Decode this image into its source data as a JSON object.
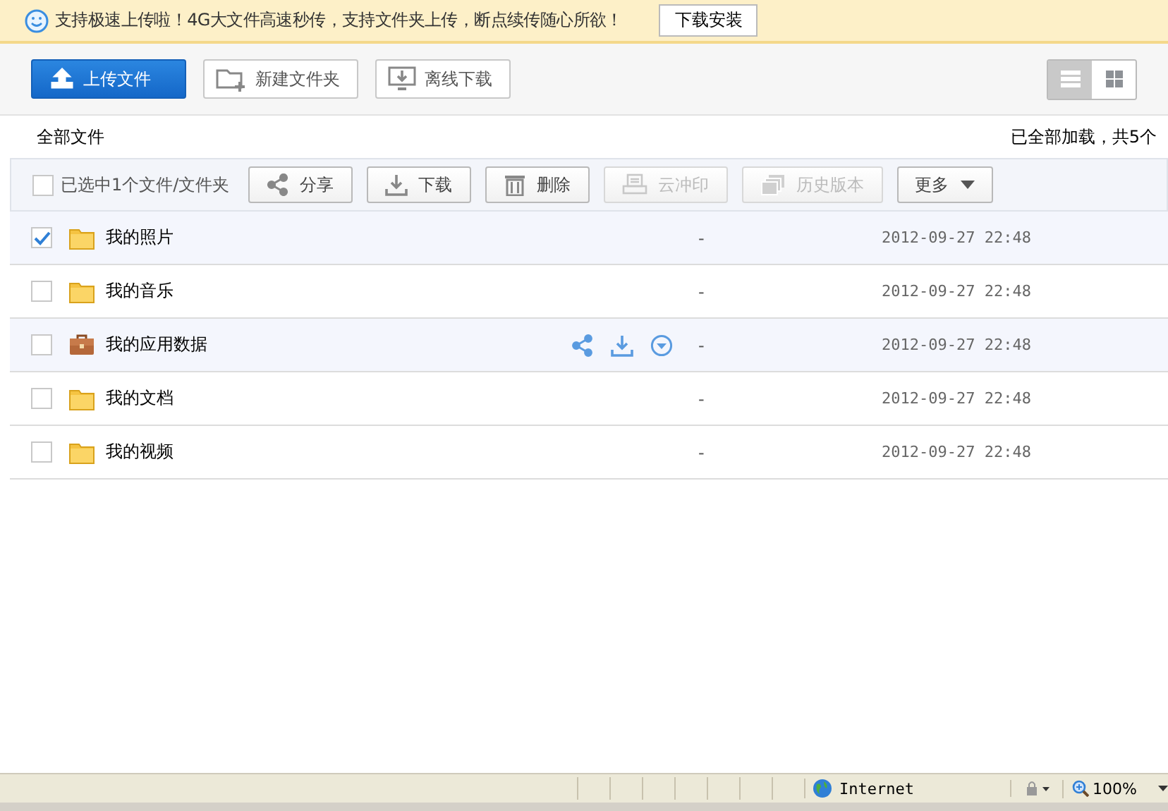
{
  "banner": {
    "message": "支持极速上传啦！4G大文件高速秒传，支持文件夹上传，断点续传随心所欲！",
    "button": "下载安装"
  },
  "toolbar": {
    "buttons": [
      {
        "label": "上传文件",
        "kind": "upload",
        "primary": true
      },
      {
        "label": "新建文件夹",
        "kind": "newfolder",
        "primary": false
      },
      {
        "label": "离线下载",
        "kind": "offline",
        "primary": false
      }
    ],
    "views": [
      {
        "kind": "list",
        "selected": true
      },
      {
        "kind": "grid",
        "selected": false
      }
    ]
  },
  "breadcrumb": "全部文件",
  "load_status": "已全部加载，共5个",
  "selection": {
    "label": "已选中1个文件/文件夹",
    "checked": false
  },
  "actions": [
    {
      "label": "分享",
      "kind": "share",
      "disabled": false
    },
    {
      "label": "下载",
      "kind": "download",
      "disabled": false
    },
    {
      "label": "删除",
      "kind": "delete",
      "disabled": false
    },
    {
      "label": "云冲印",
      "kind": "print",
      "disabled": true
    },
    {
      "label": "历史版本",
      "kind": "history",
      "disabled": true
    },
    {
      "label": "更多",
      "kind": "more",
      "disabled": false
    }
  ],
  "files": [
    {
      "name": "我的照片",
      "kind": "folder",
      "selected": true,
      "hovered": false,
      "size": "-",
      "date": "2012-09-27 22:48"
    },
    {
      "name": "我的音乐",
      "kind": "folder",
      "selected": false,
      "hovered": false,
      "size": "-",
      "date": "2012-09-27 22:48"
    },
    {
      "name": "我的应用数据",
      "kind": "app",
      "selected": false,
      "hovered": true,
      "size": "-",
      "date": "2012-09-27 22:48"
    },
    {
      "name": "我的文档",
      "kind": "folder",
      "selected": false,
      "hovered": false,
      "size": "-",
      "date": "2012-09-27 22:48"
    },
    {
      "name": "我的视频",
      "kind": "folder",
      "selected": false,
      "hovered": false,
      "size": "-",
      "date": "2012-09-27 22:48"
    }
  ],
  "status_bar": {
    "zone": "Internet",
    "zoom": "100%"
  }
}
